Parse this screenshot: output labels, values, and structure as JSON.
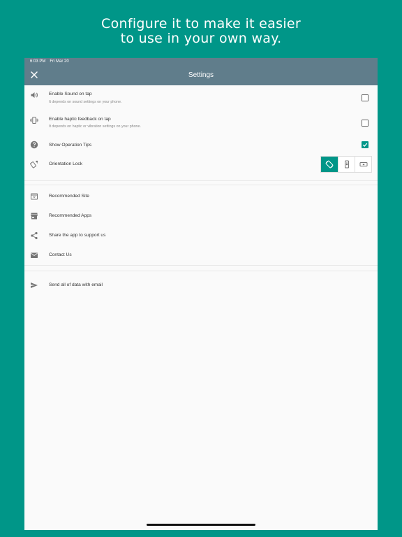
{
  "headline": {
    "line1": "Configure it to make it easier",
    "line2": "to use in your own way."
  },
  "status_bar": {
    "time": "6:03 PM",
    "date": "Fri Mar 20"
  },
  "appbar": {
    "title": "Settings"
  },
  "settings": {
    "sound": {
      "title": "Enable Sound on tap",
      "subtitle": "It depends on sound settings on your phone.",
      "checked": false
    },
    "haptic": {
      "title": "Enable haptic feedback on tap",
      "subtitle": "It depends on haptic or vibration settings on your phone.",
      "checked": false
    },
    "tips": {
      "title": "Show Operation Tips",
      "checked": true
    },
    "orientation": {
      "title": "Orientation Lock",
      "options": [
        "auto-rotate",
        "portrait",
        "landscape"
      ],
      "selected": "auto-rotate"
    }
  },
  "links": {
    "site": "Recommended Site",
    "apps": "Recommended Apps",
    "share": "Share the app to support us",
    "contact": "Contact Us"
  },
  "export": {
    "send": "Send all of data with email"
  },
  "colors": {
    "accent": "#009688",
    "appbar": "#607d8b",
    "background": "#fafafa"
  }
}
